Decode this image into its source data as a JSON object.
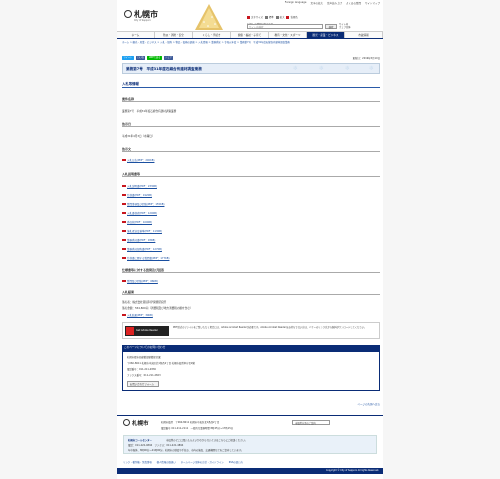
{
  "header": {
    "top_links": [
      "Foreign language",
      "文字の拡大",
      "音声読み上げ",
      "よくある質問",
      "サイトマップ"
    ],
    "logo_text": "札幌市",
    "logo_sub": "City of Sapporo",
    "util_buttons": [
      "文字サイズ",
      "標準",
      "拡大",
      "背景色"
    ],
    "search_label": "お探しの情報は何ですか",
    "search_placeholder": "サイト内検索",
    "search_button": "検索",
    "search_options": [
      "サイト内",
      "ウェブ全体"
    ]
  },
  "nav": {
    "items": [
      "ホーム",
      "防災・消防・安全",
      "くらし・手続き",
      "健康・福祉・子育て",
      "教育・文化・スポーツ",
      "観光・産業・ビジネス",
      "市政情報"
    ],
    "active_index": 5
  },
  "breadcrumb": "ホーム > 観光・産業・ビジネス > 入札・契約 > 物品・役務の調達 > 入札情報 > 業務委託 > 令和元年度 > 業務第7号　平成31年度石綿含有建材調査業務",
  "social": [
    "ツイート",
    "いいね",
    "LINEで送る",
    "シェア"
  ],
  "update_date": "更新日：2019年5月10日",
  "page_title": "業務第7号　平成31年度石綿含有建材調査業務",
  "sections": {
    "bid_info": "入札等情報",
    "case_name_h": "案件名称",
    "case_name": "業務第7号　平成31年度石綿含有建材調査業務",
    "notice_date_h": "告示日",
    "notice_date": "平成31年4月3日（水曜日）",
    "notice_h": "告示文",
    "notice_link": "入札公告(PDF：200KB)",
    "docs_h": "入札説明書等",
    "docs": [
      "入札説明書(PDF：233KB)",
      "仕様書(PDF：192KB)",
      "質問事項及び回答(PDF：155KB)",
      "入札書様式(PDF：120KB)",
      "委任状(PDF：109KB)",
      "落札者決定基準(PDF：113KB)",
      "業務委託書(PDF：93KB)",
      "業務委託契約書(PDF：127KB)",
      "仕様書に関する質問書(PDF：177KB)"
    ],
    "qa_h": "仕様書等に対する質問及び回答",
    "qa_link": "質問及び回答(PDF：66KB)",
    "result_h": "入札結果",
    "winner": "落札者：株式会社環境科学開発研究所",
    "amount": "落札金額：554,800円（消費税及び地方消費税の額を含む）",
    "result_link": "入札結果(PDF：30KB)"
  },
  "acrobat": {
    "badge": "Get Adobe Reader",
    "note": "PDF形式のファイルをご覧いただく場合には、Adobe Acrobat Readerが必要です。Adobe Acrobat Readerをお持ちでない方は、バナーのリンク先から無料ダウンロードしてください。"
  },
  "inquiry": {
    "head": "このページについてのお問い合わせ",
    "lines": [
      "札幌市都市局建築部建築保全課",
      "〒060-8611 札幌市中央区北1条西2丁目 札幌市役所本庁舎2階",
      "電話番号：011-211-2836",
      "ファクス番号：011-211-2823"
    ],
    "button": "お問い合わせフォーム"
  },
  "pagetop": "ページの先頭へ戻る",
  "footer": {
    "logo": "札幌市",
    "address": "札幌市役所　〒060-8611 札幌市中央区北1条西2丁目",
    "map_btn": "市役所庁舎のご案内",
    "tel": "電話番号 011-211-2111　一般的な業務時間 8時45分～17時15分",
    "call_title": "札幌市コールセンター",
    "call_desc": "市役所のどこに聞いたらよいかわからないときはこちらにご相談ください。",
    "call_tel": "電話：011-222-4894　ファクス：011-221-4894",
    "call_hours": "年中無休、8時00分～21時00分。札幌市の制度や手続き、市内の施設、交通機関などをご案内しています。",
    "links": [
      "リンク・著作権・免責事項",
      "個人情報の取扱い",
      "ホームページ全体の方針・ガイドライン",
      "RSSの使い方"
    ],
    "copyright": "Copyright © City of Sapporo All rights Reserved."
  }
}
